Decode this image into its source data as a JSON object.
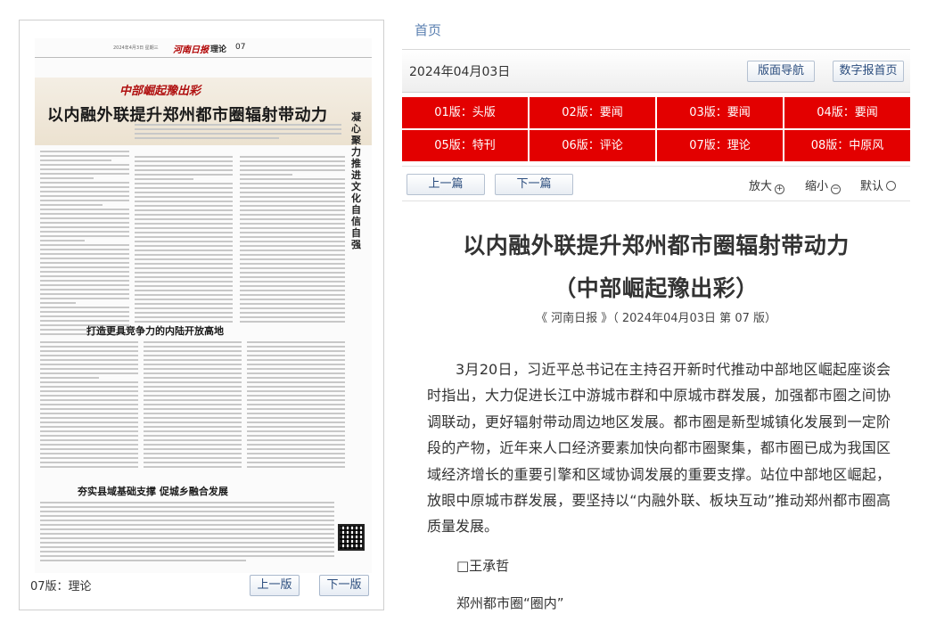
{
  "paper": {
    "masthead": {
      "date": "2024年4月3日 星期三",
      "logo": "河南日报",
      "section": "理论",
      "page_no": "07"
    },
    "kicker": "中部崛起豫出彩",
    "headline": "以内融外联提升郑州都市圈辐射带动力",
    "side_column": "凝心聚力推进文化自信自强",
    "sub_headline_1": "打造更具竞争力的内陆开放高地",
    "sub_headline_2": "夯实县域基础支撑 促城乡融合发展",
    "page_label": "07版：理论",
    "prev_label": "上一版",
    "next_label": "下一版"
  },
  "nav": {
    "home": "首页",
    "date": "2024年04月03日",
    "layout_nav": "版面导航",
    "digital_home": "数字报首页"
  },
  "editions": [
    {
      "label": "01版：头版"
    },
    {
      "label": "02版：要闻"
    },
    {
      "label": "03版：要闻"
    },
    {
      "label": "04版：要闻"
    },
    {
      "label": "05版：特刊"
    },
    {
      "label": "06版：评论"
    },
    {
      "label": "07版：理论"
    },
    {
      "label": "08版：中原风"
    }
  ],
  "pager": {
    "prev": "上一篇",
    "next": "下一篇",
    "zoom_in": "放大",
    "zoom_out": "缩小",
    "default": "默认"
  },
  "article": {
    "title_line1": "以内融外联提升郑州都市圈辐射带动力",
    "title_line2": "（中部崛起豫出彩）",
    "source": "《 河南日报 》（ 2024年04月03日 第 07 版）",
    "body": "3月20日，习近平总书记在主持召开新时代推动中部地区崛起座谈会时指出，大力促进长江中游城市群和中原城市群发展，加强都市圈之间协调联动，更好辐射带动周边地区发展。都市圈是新型城镇化发展到一定阶段的产物，近年来人口经济要素加快向都市圈聚集，都市圈已成为我国区域经济增长的重要引擎和区域协调发展的重要支撑。站位中部地区崛起，放眼中原城市群发展，要坚持以“内融外联、板块互动”推动郑州都市圈高质量发展。",
    "author": "□王承哲",
    "subhead": "郑州都市圈“圈内”"
  },
  "colors": {
    "edition_red": "#e30000",
    "link_blue": "#5a7fb0"
  }
}
